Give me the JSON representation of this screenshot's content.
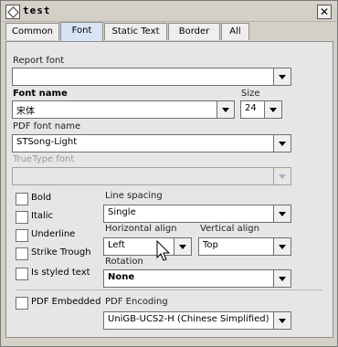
{
  "window": {
    "title": "test",
    "close_label": "✕"
  },
  "tabs": [
    "Common",
    "Font",
    "Static Text",
    "Border",
    "All"
  ],
  "active_tab": "Font",
  "report_font": {
    "label": "Report font",
    "value": ""
  },
  "font_name": {
    "label": "Font name",
    "value": "宋体"
  },
  "size": {
    "label": "Size",
    "value": "24"
  },
  "pdf_font_name": {
    "label": "PDF font name",
    "value": "STSong-Light"
  },
  "truetype_font": {
    "label": "TrueType font",
    "value": ""
  },
  "checkboxes": {
    "bold": "Bold",
    "italic": "Italic",
    "underline": "Underline",
    "strike": "Strike Trough",
    "styled": "Is styled text",
    "pdf_embedded": "PDF Embedded"
  },
  "line_spacing": {
    "label": "Line spacing",
    "value": "Single"
  },
  "horizontal_align": {
    "label": "Horizontal align",
    "value": "Left"
  },
  "vertical_align": {
    "label": "Vertical align",
    "value": "Top"
  },
  "rotation": {
    "label": "Rotation",
    "value": "None"
  },
  "pdf_encoding": {
    "label": "PDF Encoding",
    "value": "UniGB-UCS2-H (Chinese Simplified)"
  }
}
